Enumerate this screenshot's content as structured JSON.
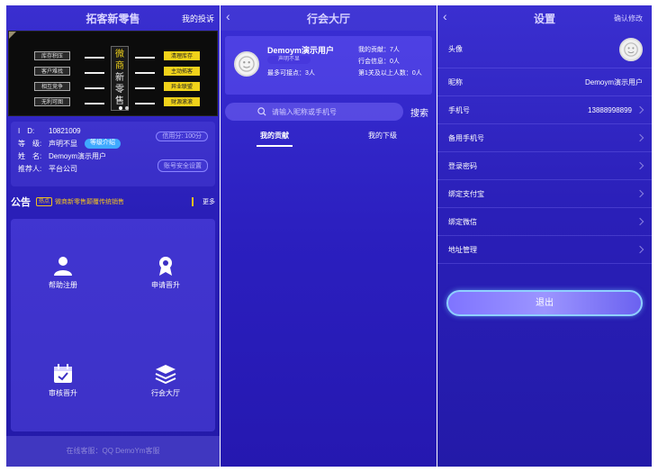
{
  "home": {
    "title": "拓客新零售",
    "right_link": "我的投诉",
    "banner": {
      "left_tags": [
        "库存积压",
        "客户难找",
        "相互竞争",
        "无利可图"
      ],
      "right_tags": [
        "清理库存",
        "主动拓客",
        "异业联盟",
        "财源滚滚"
      ],
      "center_chars": [
        "微",
        "商",
        "新",
        "零",
        "售"
      ]
    },
    "info": {
      "id_label": "I　D:",
      "id_value": "10821009",
      "level_label": "等　级:",
      "level_value": "声明不显",
      "level_btn": "等级介绍",
      "name_label": "姓　名:",
      "name_value": "Demoym演示用户",
      "referrer_label": "推荐人:",
      "referrer_value": "平台公司",
      "credit_btn": "信用分: 100分",
      "security_btn": "账号安全设置"
    },
    "notice": {
      "title": "公告",
      "badge": "热点",
      "text": "微商新零售颠覆传统销售",
      "more": "更多"
    },
    "grid": [
      {
        "label": "帮助注册",
        "icon": "user-icon"
      },
      {
        "label": "申请晋升",
        "icon": "award-icon"
      },
      {
        "label": "审核晋升",
        "icon": "calendar-check-icon"
      },
      {
        "label": "行会大厅",
        "icon": "layers-icon"
      }
    ],
    "footer": "在线客服：QQ DemoYm客服"
  },
  "guild": {
    "title": "行会大厅",
    "user": {
      "name": "Demoym演示用户",
      "level": "声明不显",
      "claimable": "最多可接点：3人",
      "contribution": "我的贡献：7人",
      "guild_info": "行会信息：0人",
      "first_level": "第1关及以上人数：0人"
    },
    "search_placeholder": "请输入昵称或手机号",
    "search_btn": "搜索",
    "tabs": [
      "我的贡献",
      "我的下级"
    ]
  },
  "settings": {
    "title": "设置",
    "confirm": "确认修改",
    "rows": [
      {
        "label": "头像",
        "value": ""
      },
      {
        "label": "昵称",
        "value": "Demoym演示用户"
      },
      {
        "label": "手机号",
        "value": "13888998899"
      },
      {
        "label": "备用手机号",
        "value": ""
      },
      {
        "label": "登录密码",
        "value": ""
      },
      {
        "label": "绑定支付宝",
        "value": ""
      },
      {
        "label": "绑定微信",
        "value": ""
      },
      {
        "label": "地址管理",
        "value": ""
      }
    ],
    "logout": "退出"
  },
  "colors": {
    "bg": "#2a1fb8",
    "accent_yellow": "#f0c020",
    "pill_blue": "#3fa9ff"
  }
}
